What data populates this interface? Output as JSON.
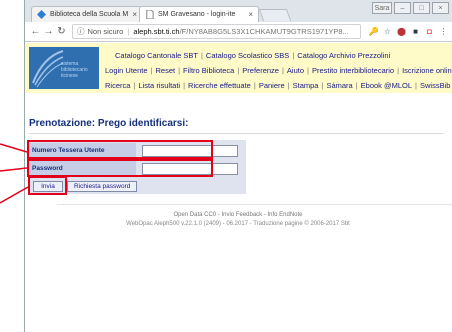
{
  "browser": {
    "tabs": [
      {
        "label": "Biblioteca della Scuola M",
        "close": "×"
      },
      {
        "label": "SM Gravesano - login-ite",
        "close": "×"
      }
    ],
    "window_controls": {
      "user": "Sara",
      "minimize": "–",
      "maximize": "□",
      "close": "×"
    },
    "address": {
      "security": "Non sicuro",
      "separator": "|",
      "host": "aleph.sbt.ti.ch",
      "path": "/F/NY8AB8G5LS3X1CHKAMUT9GTRS1971YP8..."
    }
  },
  "site": {
    "logo_text": [
      "sistema",
      "bibliotecario",
      "ticinese"
    ],
    "menu_line1": [
      "Catalogo Cantonale SBT",
      "Catalogo Scolastico SBS",
      "Catalogo Archivio Prezzolini"
    ],
    "menu_line2": [
      "Login Utente",
      "Reset",
      "Filtro Biblioteca",
      "Preferenze",
      "Aiuto",
      "Prestito interbibliotecario",
      "Iscrizione online"
    ],
    "menu_line3": [
      "Ricerca",
      "Lista risultati",
      "Ricerche effettuate",
      "Paniere",
      "Stampa",
      "Sàmara",
      "Ebook @MLOL",
      "SwissBib"
    ]
  },
  "page": {
    "heading": "Prenotazione: Prego identificarsi:",
    "form": {
      "card_label": "Numero Tessera Utente",
      "card_value": "",
      "password_label": "Password",
      "password_value": "",
      "submit_label": "Invia",
      "request_password_label": "Richiesta password"
    },
    "footer_line1": "Open Data CC0  -  Invio Feedback  -  Info EndNote",
    "footer_line2": "WebOpac Aleph500 v.22.1.0 (2409) - 06.2017 - Traduzione pagine © 2006-2017 Sbt"
  },
  "colors": {
    "header_bg": "#fffbc8",
    "logo_bg": "#2f6fb0",
    "highlight": "#e3001b",
    "link": "#1a1a8a"
  }
}
